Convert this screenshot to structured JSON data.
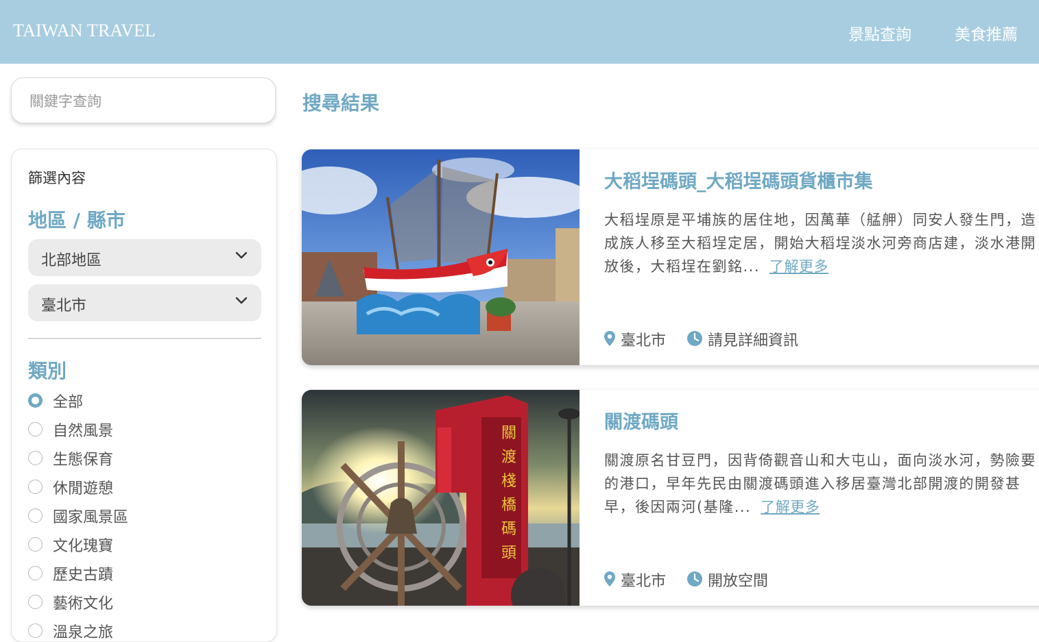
{
  "header": {
    "brand": "TAIWAN TRAVEL",
    "nav": [
      "景點查詢",
      "美食推薦"
    ]
  },
  "search": {
    "placeholder": "關鍵字查詢",
    "value": ""
  },
  "filters": {
    "title": "篩選內容",
    "region_heading": "地區 / 縣市",
    "region_select": "北部地區",
    "city_select": "臺北市",
    "category_heading": "類別",
    "categories": [
      {
        "label": "全部",
        "checked": true
      },
      {
        "label": "自然風景",
        "checked": false
      },
      {
        "label": "生態保育",
        "checked": false
      },
      {
        "label": "休閒遊憩",
        "checked": false
      },
      {
        "label": "國家風景區",
        "checked": false
      },
      {
        "label": "文化瑰寶",
        "checked": false
      },
      {
        "label": "歷史古蹟",
        "checked": false
      },
      {
        "label": "藝術文化",
        "checked": false
      },
      {
        "label": "溫泉之旅",
        "checked": false
      }
    ]
  },
  "results": {
    "title": "搜尋結果",
    "items": [
      {
        "title": "大稻埕碼頭_大稻埕碼頭貨櫃市集",
        "description": "大稻埕原是平埔族的居住地，因萬華（艋舺）同安人發生門，造成族人移至大稻埕定居，開始大稻埕淡水河旁商店建，淡水港開放後，大稻埕在劉銘...",
        "more": "了解更多",
        "location": "臺北市",
        "hours": "請見詳細資訊",
        "image": "ship-photo"
      },
      {
        "title": "關渡碼頭",
        "description": "關渡原名甘豆門，因背倚觀音山和大屯山，面向淡水河，勢險要的港口，早年先民由關渡碼頭進入移居臺灣北部開渡的開發甚早，後因兩河(基隆...",
        "more": "了解更多",
        "location": "臺北市",
        "hours": "開放空間",
        "image": "pier-sign-photo"
      }
    ]
  },
  "colors": {
    "header_bg": "#a8cde0",
    "accent": "#6fa8c4",
    "select_bg": "#ebebeb"
  },
  "icons": {
    "location": "map-pin-icon",
    "hours": "clock-icon",
    "select": "chevron-down-icon"
  }
}
